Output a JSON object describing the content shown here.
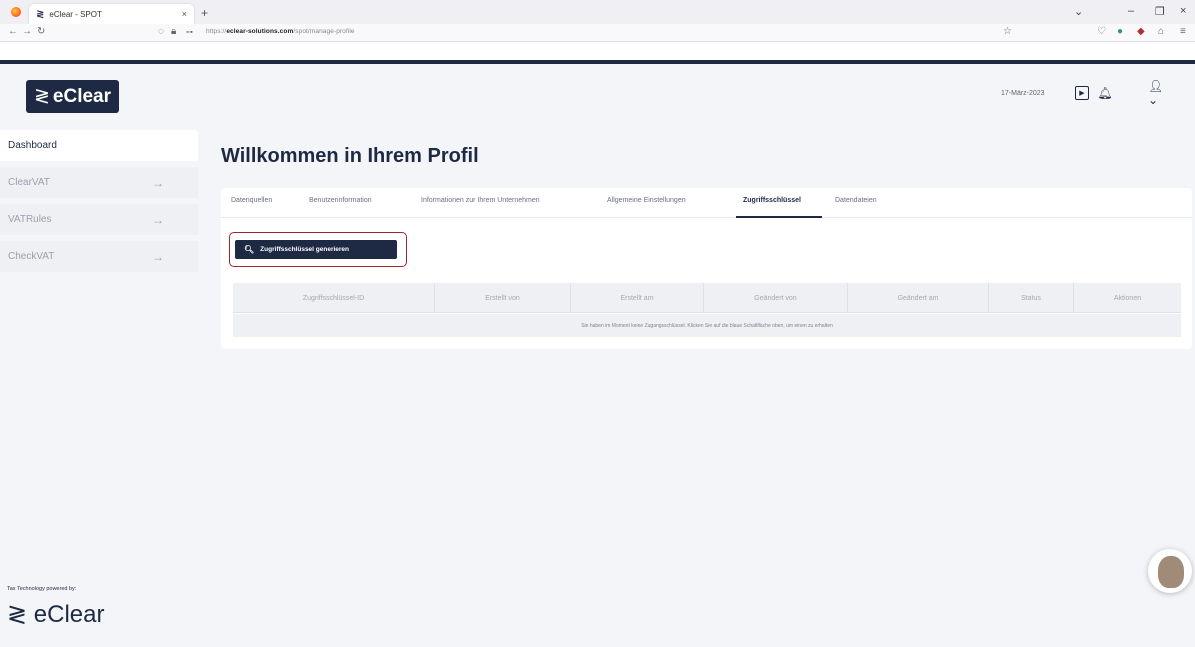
{
  "browser": {
    "tab_title": "eClear - SPOT",
    "tab_close": "×",
    "new_tab": "+",
    "url_prefix": "https://",
    "url_domain": "eclear-solutions.com",
    "url_path": "/spot/manage-profile"
  },
  "header": {
    "logo_text": "eClear",
    "date": "17-März-2023"
  },
  "sidebar": {
    "items": [
      {
        "label": "Dashboard",
        "active": true
      },
      {
        "label": "ClearVAT",
        "arrow": "→"
      },
      {
        "label": "VATRules",
        "arrow": "→"
      },
      {
        "label": "CheckVAT",
        "arrow": "→"
      }
    ],
    "powered_by": "Tax Technology powered by:",
    "brand": "eClear"
  },
  "main": {
    "title": "Willkommen in Ihrem Profil",
    "tabs": [
      {
        "label": "Datenquellen"
      },
      {
        "label": "Benutzerinformation"
      },
      {
        "label": "Informationen zur Ihrem Unternehmen"
      },
      {
        "label": "Allgemeine Einstellungen"
      },
      {
        "label": "Zugriffsschlüssel",
        "active": true
      },
      {
        "label": "Datendateien"
      }
    ],
    "generate_button": "Zugriffsschlüssel generieren",
    "table": {
      "columns": [
        "Zugriffsschlüssel-ID",
        "Erstellt von",
        "Erstellt am",
        "Geändert von",
        "Geändert am",
        "Status",
        "Aktionen"
      ],
      "empty_message": "Sie haben im Moment keine Zugangsschlüssel. Klicken Sie auf die blaue Schaltfläche oben, um einen zu erhalten"
    }
  },
  "colors": {
    "brand": "#1e2a44",
    "highlight": "#a0282d",
    "background": "#f4f5f8"
  }
}
